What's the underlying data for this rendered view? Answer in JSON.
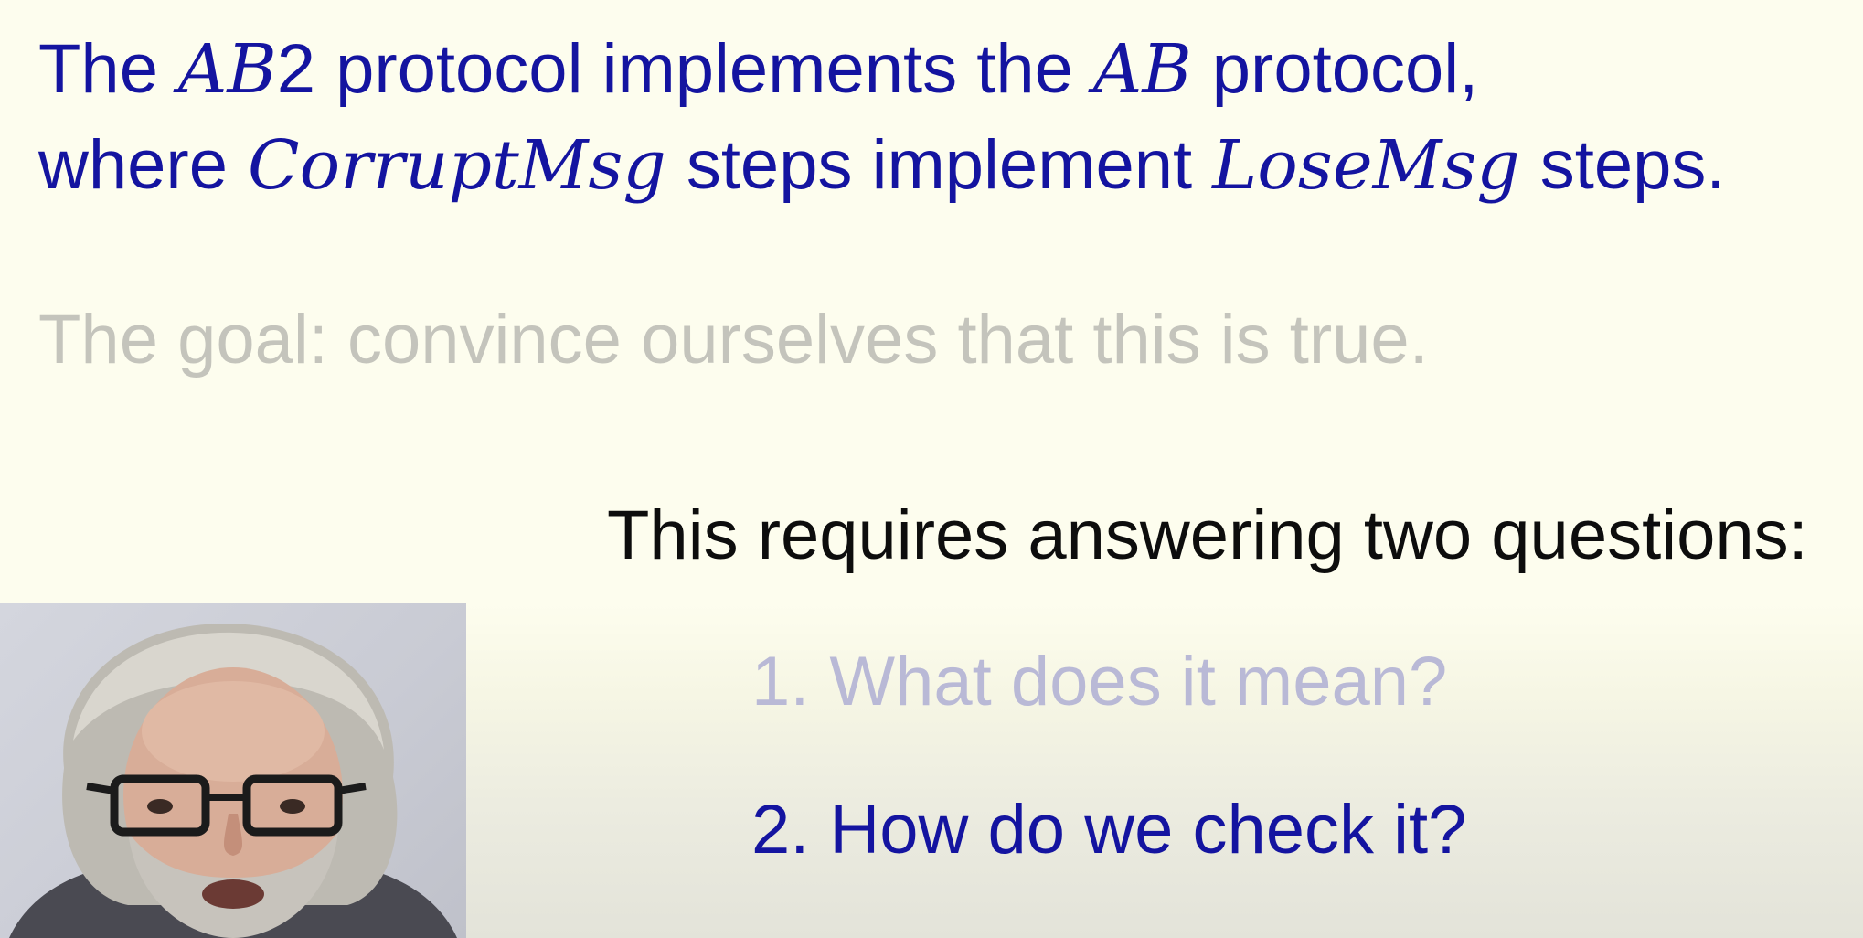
{
  "slide": {
    "line1": {
      "t1": "The",
      "m1": "AB",
      "t2": "2",
      "t3": "protocol implements the",
      "m2": "AB",
      "t4": "protocol,"
    },
    "line2": {
      "t1": "where",
      "m1": "CorruptMsg",
      "t2": "steps implement",
      "m2": "LoseMsg",
      "t3": "steps."
    },
    "goal": "The goal: convince ourselves that this is true.",
    "requires": "This requires answering two questions:",
    "questions": [
      {
        "number": "1.",
        "text": "What does it mean?"
      },
      {
        "number": "2.",
        "text": "How do we check it?"
      }
    ]
  },
  "colors": {
    "background": "#fdfdee",
    "primary_text": "#1414a0",
    "faded_text": "#c4c4bc",
    "emphasis_text": "#0d0d0d",
    "inactive_question": "#b9b9d6"
  },
  "webcam": {
    "icon": "presenter-video-icon"
  }
}
